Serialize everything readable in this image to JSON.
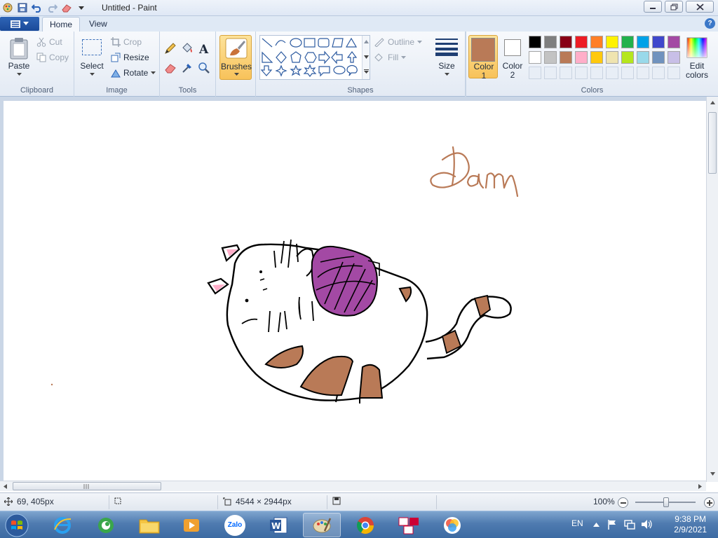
{
  "window": {
    "title": "Untitled - Paint"
  },
  "tabs": [
    {
      "label": "Home"
    },
    {
      "label": "View"
    }
  ],
  "ribbon": {
    "clipboard": {
      "group_label": "Clipboard",
      "paste": "Paste",
      "cut": "Cut",
      "copy": "Copy"
    },
    "image": {
      "group_label": "Image",
      "select": "Select",
      "crop": "Crop",
      "resize": "Resize",
      "rotate": "Rotate"
    },
    "tools": {
      "group_label": "Tools"
    },
    "brushes": {
      "label": "Brushes"
    },
    "shapes": {
      "group_label": "Shapes",
      "outline": "Outline",
      "fill": "Fill"
    },
    "size": {
      "label": "Size"
    },
    "colors": {
      "group_label": "Colors",
      "color1_label": "Color",
      "color1_num": "1",
      "color2_label": "Color",
      "color2_num": "2",
      "edit_colors": "Edit",
      "edit_colors2": "colors",
      "color1": "#b97a57",
      "color2": "#ffffff",
      "palette_row1": [
        "#000000",
        "#7f7f7f",
        "#880015",
        "#ed1c24",
        "#ff7f27",
        "#fff200",
        "#22b14c",
        "#00a2e8",
        "#3f48cc",
        "#a349a4"
      ],
      "palette_row2": [
        "#ffffff",
        "#c3c3c3",
        "#b97a57",
        "#ffaec9",
        "#ffc90e",
        "#efe4b0",
        "#b5e61d",
        "#99d9ea",
        "#7092be",
        "#c8bfe7"
      ]
    }
  },
  "canvas": {
    "handwriting": "Dam",
    "cat_fill": "#b97a57",
    "yarn_fill": "#a349a4"
  },
  "status": {
    "cursor_pos": "69, 405px",
    "image_size": "4544 × 2944px",
    "zoom": "100%"
  },
  "taskbar": {
    "apps": [
      "internet-explorer",
      "coccoc-browser",
      "file-explorer",
      "media-player",
      "zalo",
      "word",
      "paint",
      "chrome",
      "unikey",
      "photos"
    ],
    "zalo_label": "Zalo",
    "lang": "EN",
    "time": "9:38 PM",
    "date": "2/9/2021"
  }
}
